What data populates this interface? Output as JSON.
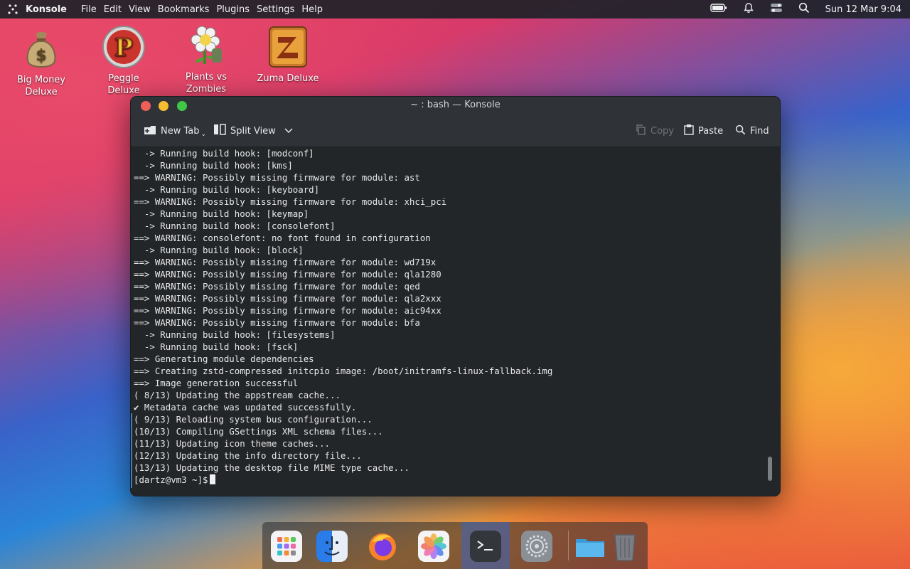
{
  "menubar": {
    "app_name": "Konsole",
    "menus": [
      "File",
      "Edit",
      "View",
      "Bookmarks",
      "Plugins",
      "Settings",
      "Help"
    ],
    "clock": "Sun 12 Mar 9:04",
    "icons": [
      "battery-icon",
      "bell-icon",
      "toggle-icon",
      "search-icon"
    ]
  },
  "desktop": {
    "icons": [
      {
        "label": "Big Money Deluxe"
      },
      {
        "label": "Peggle Deluxe"
      },
      {
        "label": "Plants vs Zombies"
      },
      {
        "label": "Zuma Deluxe"
      }
    ]
  },
  "window": {
    "title": "~ : bash — Konsole",
    "toolbar": {
      "new_tab": "New Tab",
      "split_view": "Split View",
      "copy": "Copy",
      "paste": "Paste",
      "find": "Find"
    },
    "terminal": {
      "lines": [
        "  -> Running build hook: [modconf]",
        "  -> Running build hook: [kms]",
        "==> WARNING: Possibly missing firmware for module: ast",
        "  -> Running build hook: [keyboard]",
        "==> WARNING: Possibly missing firmware for module: xhci_pci",
        "  -> Running build hook: [keymap]",
        "  -> Running build hook: [consolefont]",
        "==> WARNING: consolefont: no font found in configuration",
        "  -> Running build hook: [block]",
        "==> WARNING: Possibly missing firmware for module: wd719x",
        "==> WARNING: Possibly missing firmware for module: qla1280",
        "==> WARNING: Possibly missing firmware for module: qed",
        "==> WARNING: Possibly missing firmware for module: qla2xxx",
        "==> WARNING: Possibly missing firmware for module: aic94xx",
        "==> WARNING: Possibly missing firmware for module: bfa",
        "  -> Running build hook: [filesystems]",
        "  -> Running build hook: [fsck]",
        "==> Generating module dependencies",
        "==> Creating zstd-compressed initcpio image: /boot/initramfs-linux-fallback.img",
        "==> Image generation successful",
        "( 8/13) Updating the appstream cache...",
        "✔ Metadata cache was updated successfully.",
        "( 9/13) Reloading system bus configuration...",
        "(10/13) Compiling GSettings XML schema files...",
        "(11/13) Updating icon theme caches...",
        "(12/13) Updating the info directory file...",
        "(13/13) Updating the desktop file MIME type cache..."
      ],
      "prompt": "[dartz@vm3 ~]$"
    }
  },
  "dock": {
    "items": [
      "app-launcher-icon",
      "finder-icon",
      "firefox-icon",
      "photos-icon",
      "terminal-icon",
      "settings-icon",
      "folder-icon",
      "trash-icon"
    ]
  },
  "colors": {
    "accent": "#3d7ec0",
    "terminal_bg": "#232629",
    "close": "#ee5f57",
    "minimize": "#f5bd2f",
    "maximize": "#3ec647"
  }
}
